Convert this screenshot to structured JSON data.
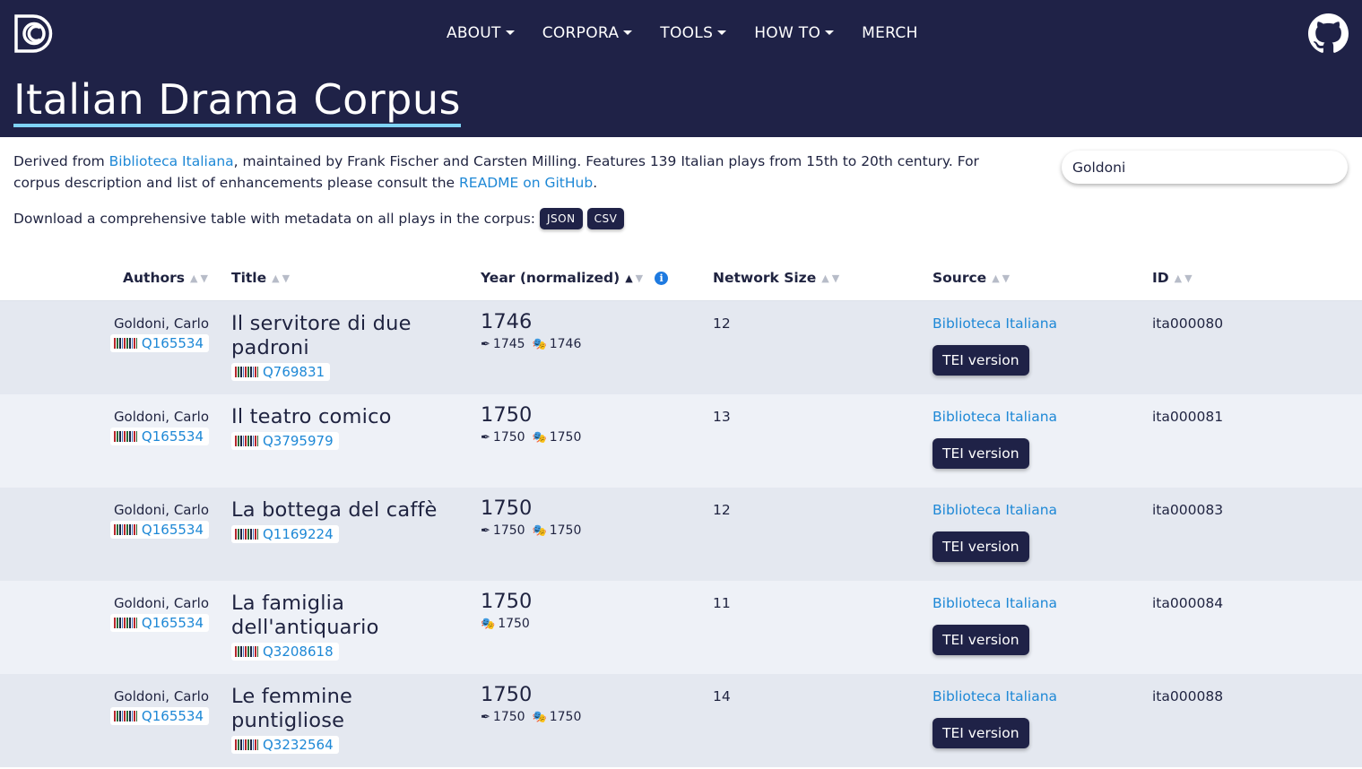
{
  "nav": {
    "items": [
      {
        "label": "ABOUT",
        "dropdown": true
      },
      {
        "label": "CORPORA",
        "dropdown": true
      },
      {
        "label": "TOOLS",
        "dropdown": true
      },
      {
        "label": "HOW TO",
        "dropdown": true
      },
      {
        "label": "MERCH",
        "dropdown": false
      }
    ]
  },
  "header": {
    "title": "Italian Drama Corpus"
  },
  "intro": {
    "pre": "Derived from ",
    "link1": "Biblioteca Italiana",
    "mid": ", maintained by Frank Fischer and Carsten Milling. Features 139 Italian plays from 15th to 20th century. For corpus description and list of enhancements please consult the ",
    "link2": "README on GitHub",
    "post": "."
  },
  "download": {
    "label": "Download a comprehensive table with metadata on all plays in the corpus:",
    "json": "JSON",
    "csv": "CSV"
  },
  "search": {
    "value": "Goldoni"
  },
  "columns": {
    "authors": "Authors",
    "title": "Title",
    "year": "Year (normalized)",
    "network": "Network Size",
    "source": "Source",
    "id": "ID"
  },
  "tei_label": "TEI version",
  "rows": [
    {
      "author": "Goldoni, Carlo",
      "author_wd": "Q165534",
      "title": "Il servitore di due padroni",
      "title_wd": "Q769831",
      "year": "1746",
      "written": "1745",
      "premiered": "1746",
      "network": "12",
      "source": "Biblioteca Italiana",
      "id": "ita000080"
    },
    {
      "author": "Goldoni, Carlo",
      "author_wd": "Q165534",
      "title": "Il teatro comico",
      "title_wd": "Q3795979",
      "year": "1750",
      "written": "1750",
      "premiered": "1750",
      "network": "13",
      "source": "Biblioteca Italiana",
      "id": "ita000081"
    },
    {
      "author": "Goldoni, Carlo",
      "author_wd": "Q165534",
      "title": "La bottega del caffè",
      "title_wd": "Q1169224",
      "year": "1750",
      "written": "1750",
      "premiered": "1750",
      "network": "12",
      "source": "Biblioteca Italiana",
      "id": "ita000083"
    },
    {
      "author": "Goldoni, Carlo",
      "author_wd": "Q165534",
      "title": "La famiglia dell'antiquario",
      "title_wd": "Q3208618",
      "year": "1750",
      "written": "",
      "premiered": "1750",
      "network": "11",
      "source": "Biblioteca Italiana",
      "id": "ita000084"
    },
    {
      "author": "Goldoni, Carlo",
      "author_wd": "Q165534",
      "title": "Le femmine puntigliose",
      "title_wd": "Q3232564",
      "year": "1750",
      "written": "1750",
      "premiered": "1750",
      "network": "14",
      "source": "Biblioteca Italiana",
      "id": "ita000088"
    }
  ]
}
